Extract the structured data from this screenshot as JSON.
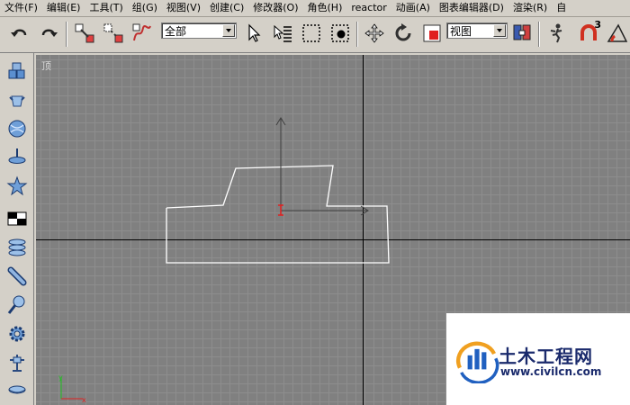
{
  "menu": {
    "items": [
      {
        "label": "文件(F)"
      },
      {
        "label": "编辑(E)"
      },
      {
        "label": "工具(T)"
      },
      {
        "label": "组(G)"
      },
      {
        "label": "视图(V)"
      },
      {
        "label": "创建(C)"
      },
      {
        "label": "修改器(O)"
      },
      {
        "label": "角色(H)"
      },
      {
        "label": "reactor"
      },
      {
        "label": "动画(A)"
      },
      {
        "label": "图表编辑器(D)"
      },
      {
        "label": "渲染(R)"
      },
      {
        "label": "自"
      }
    ]
  },
  "toolbar": {
    "selection_filter": "全部",
    "reference_coord": "视图",
    "snap_label": "3"
  },
  "viewport": {
    "label": "顶"
  },
  "watermark": {
    "title": "土木工程网",
    "url": "www.civilcn.com"
  },
  "colors": {
    "viewport_bg": "#808080",
    "grid_line": "#8d8d8d",
    "shape_line": "#ffffff",
    "axis_line": "#000000"
  }
}
